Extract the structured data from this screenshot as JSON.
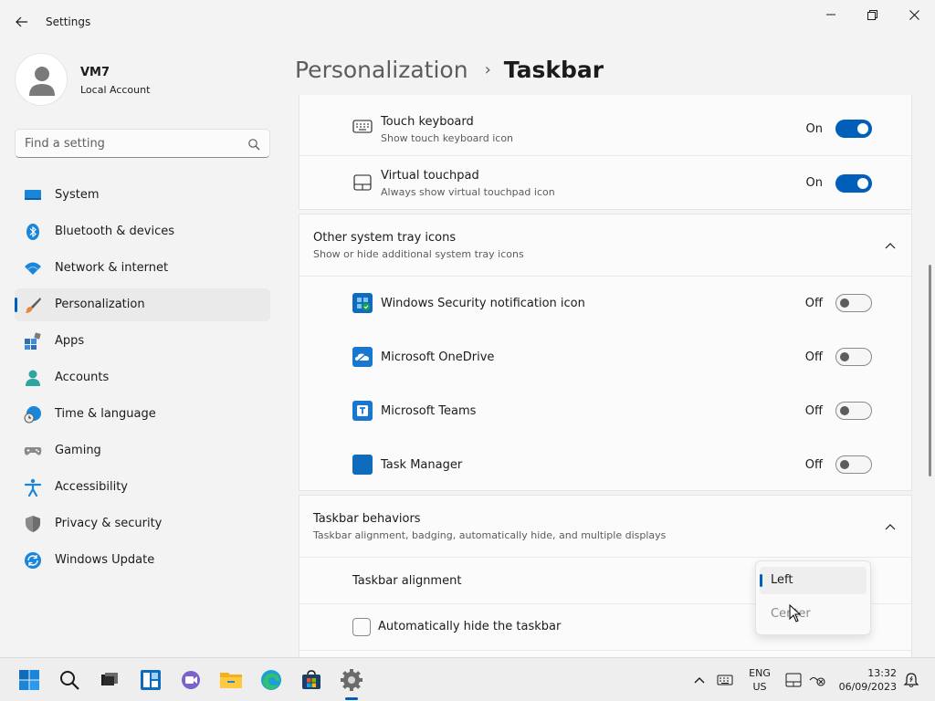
{
  "window": {
    "title": "Settings"
  },
  "account": {
    "name": "VM7",
    "type": "Local Account"
  },
  "search": {
    "placeholder": "Find a setting"
  },
  "nav": {
    "items": [
      {
        "label": "System",
        "icon": "system-icon"
      },
      {
        "label": "Bluetooth & devices",
        "icon": "bluetooth-icon"
      },
      {
        "label": "Network & internet",
        "icon": "wifi-icon"
      },
      {
        "label": "Personalization",
        "icon": "brush-icon",
        "active": true
      },
      {
        "label": "Apps",
        "icon": "apps-icon"
      },
      {
        "label": "Accounts",
        "icon": "accounts-icon"
      },
      {
        "label": "Time & language",
        "icon": "globe-clock-icon"
      },
      {
        "label": "Gaming",
        "icon": "gamepad-icon"
      },
      {
        "label": "Accessibility",
        "icon": "accessibility-icon"
      },
      {
        "label": "Privacy & security",
        "icon": "shield-icon"
      },
      {
        "label": "Windows Update",
        "icon": "update-icon"
      }
    ]
  },
  "breadcrumb": {
    "parent": "Personalization",
    "separator": "›",
    "current": "Taskbar"
  },
  "tray_corner": {
    "touch_keyboard": {
      "title": "Touch keyboard",
      "subtitle": "Show touch keyboard icon",
      "state": "On",
      "on": true
    },
    "virtual_touchpad": {
      "title": "Virtual touchpad",
      "subtitle": "Always show virtual touchpad icon",
      "state": "On",
      "on": true
    }
  },
  "other_tray": {
    "title": "Other system tray icons",
    "subtitle": "Show or hide additional system tray icons",
    "items": [
      {
        "title": "Windows Security notification icon",
        "state": "Off",
        "on": false
      },
      {
        "title": "Microsoft OneDrive",
        "state": "Off",
        "on": false
      },
      {
        "title": "Microsoft Teams",
        "state": "Off",
        "on": false
      },
      {
        "title": "Task Manager",
        "state": "Off",
        "on": false
      }
    ]
  },
  "behaviors": {
    "title": "Taskbar behaviors",
    "subtitle": "Taskbar alignment, badging, automatically hide, and multiple displays",
    "alignment_label": "Taskbar alignment",
    "alignment_options": [
      "Left",
      "Center"
    ],
    "alignment_selected": "Left",
    "autohide_label": "Automatically hide the taskbar",
    "autohide_checked": false
  },
  "taskbar": {
    "lang_line1": "ENG",
    "lang_line2": "US",
    "time": "13:32",
    "date": "06/09/2023"
  },
  "colors": {
    "accent": "#005fb8",
    "background": "#f3f3f3",
    "card": "#fbfbfb"
  }
}
